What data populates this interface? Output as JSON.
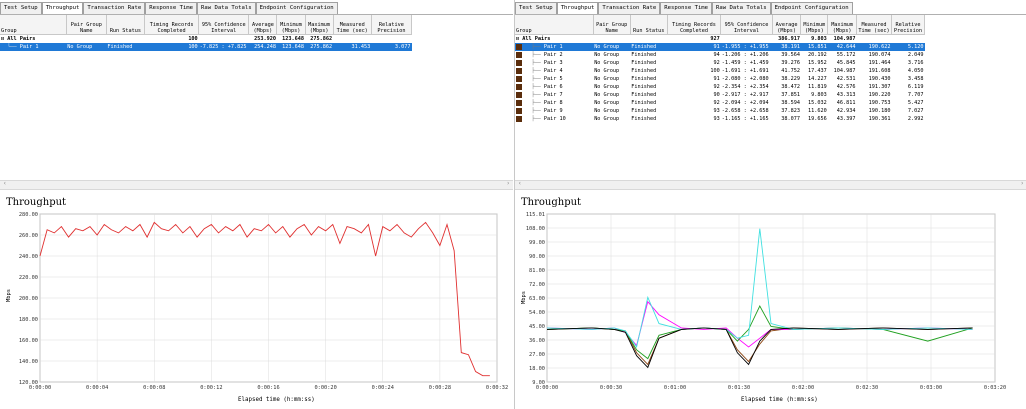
{
  "tabs": [
    "Test Setup",
    "Throughput",
    "Transaction Rate",
    "Response Time",
    "Raw Data Totals",
    "Endpoint Configuration"
  ],
  "left": {
    "headers": [
      "Group",
      "Pair Group Name",
      "Run Status",
      "Timing Records Completed",
      "95% Confidence Interval",
      "Average (Mbps)",
      "Minimum (Mbps)",
      "Maximum (Mbps)",
      "Measured Time (sec)",
      "Relative Precision"
    ],
    "all_pairs": {
      "label": "All Pairs",
      "records": "100",
      "average": "253.920",
      "minimum": "123.648",
      "maximum": "275.862"
    },
    "rows": [
      {
        "pair": "Pair 1",
        "group": "No Group",
        "status": "Finished",
        "records": "100",
        "ci": "-7.825 : +7.825",
        "average": "254.248",
        "minimum": "123.648",
        "maximum": "275.862",
        "time": "31.453",
        "precision": "3.077"
      }
    ],
    "chart_title": "Throughput",
    "y_label": "Mbps",
    "x_label": "Elapsed time (h:mm:ss)",
    "y_ticks": [
      "280.00",
      "260.00",
      "240.00",
      "220.00",
      "200.00",
      "180.00",
      "160.00",
      "140.00",
      "120.00"
    ],
    "x_ticks": [
      "0:00:00",
      "0:00:04",
      "0:00:08",
      "0:00:12",
      "0:00:16",
      "0:00:20",
      "0:00:24",
      "0:00:28",
      "0:00:32"
    ]
  },
  "right": {
    "headers": [
      "Group",
      "Pair Group Name",
      "Run Status",
      "Timing Records Completed",
      "95% Confidence Interval",
      "Average (Mbps)",
      "Minimum (Mbps)",
      "Maximum (Mbps)",
      "Measured Time (sec)",
      "Relative Precision"
    ],
    "all_pairs": {
      "label": "All Pairs",
      "records": "927",
      "average": "386.917",
      "minimum": "9.803",
      "maximum": "104.987"
    },
    "rows": [
      {
        "pair": "Pair 1",
        "group": "No Group",
        "status": "Finished",
        "records": "91",
        "ci": "-1.955 : +1.955",
        "average": "38.191",
        "minimum": "15.851",
        "maximum": "42.644",
        "time": "190.622",
        "precision": "5.120"
      },
      {
        "pair": "Pair 2",
        "group": "No Group",
        "status": "Finished",
        "records": "94",
        "ci": "-1.206 : +1.206",
        "average": "39.564",
        "minimum": "20.192",
        "maximum": "55.172",
        "time": "190.074",
        "precision": "2.049"
      },
      {
        "pair": "Pair 3",
        "group": "No Group",
        "status": "Finished",
        "records": "92",
        "ci": "-1.459 : +1.459",
        "average": "39.276",
        "minimum": "15.952",
        "maximum": "45.845",
        "time": "191.464",
        "precision": "3.716"
      },
      {
        "pair": "Pair 4",
        "group": "No Group",
        "status": "Finished",
        "records": "100",
        "ci": "-1.691 : +1.691",
        "average": "41.752",
        "minimum": "17.437",
        "maximum": "104.987",
        "time": "191.608",
        "precision": "4.050"
      },
      {
        "pair": "Pair 5",
        "group": "No Group",
        "status": "Finished",
        "records": "91",
        "ci": "-2.080 : +2.080",
        "average": "38.229",
        "minimum": "14.227",
        "maximum": "42.531",
        "time": "190.430",
        "precision": "3.458"
      },
      {
        "pair": "Pair 6",
        "group": "No Group",
        "status": "Finished",
        "records": "92",
        "ci": "-2.354 : +2.354",
        "average": "38.472",
        "minimum": "11.819",
        "maximum": "42.576",
        "time": "191.307",
        "precision": "6.119"
      },
      {
        "pair": "Pair 7",
        "group": "No Group",
        "status": "Finished",
        "records": "90",
        "ci": "-2.917 : +2.917",
        "average": "37.851",
        "minimum": "9.803",
        "maximum": "43.313",
        "time": "190.220",
        "precision": "7.707"
      },
      {
        "pair": "Pair 8",
        "group": "No Group",
        "status": "Finished",
        "records": "92",
        "ci": "-2.094 : +2.094",
        "average": "38.594",
        "minimum": "15.032",
        "maximum": "46.811",
        "time": "190.753",
        "precision": "5.427"
      },
      {
        "pair": "Pair 9",
        "group": "No Group",
        "status": "Finished",
        "records": "93",
        "ci": "-2.658 : +2.658",
        "average": "37.823",
        "minimum": "11.620",
        "maximum": "42.934",
        "time": "190.180",
        "precision": "7.027"
      },
      {
        "pair": "Pair 10",
        "group": "No Group",
        "status": "Finished",
        "records": "93",
        "ci": "-1.165 : +1.165",
        "average": "38.077",
        "minimum": "19.656",
        "maximum": "43.397",
        "time": "190.361",
        "precision": "2.992"
      }
    ],
    "chart_title": "Throughput",
    "y_label": "Mbps",
    "x_label": "Elapsed time (h:mm:ss)",
    "y_ticks": [
      "115.01",
      "108.00",
      "99.00",
      "90.00",
      "81.00",
      "72.00",
      "63.00",
      "54.00",
      "45.00",
      "36.00",
      "27.00",
      "18.00",
      "9.00"
    ],
    "x_ticks": [
      "0:00:00",
      "0:00:30",
      "0:01:00",
      "0:01:30",
      "0:02:00",
      "0:02:30",
      "0:03:00",
      "0:03:20"
    ]
  },
  "chart_data": [
    {
      "type": "line",
      "title": "Throughput",
      "xlabel": "Elapsed time (h:mm:ss)",
      "ylabel": "Mbps",
      "ylim": [
        120,
        280
      ],
      "xlim": [
        0,
        32
      ],
      "series": [
        {
          "name": "Pair 1",
          "color": "#e03030",
          "x": [
            0,
            0.5,
            1,
            1.5,
            2,
            2.5,
            3,
            3.5,
            4,
            4.5,
            5,
            5.5,
            6,
            6.5,
            7,
            7.5,
            8,
            8.5,
            9,
            9.5,
            10,
            10.5,
            11,
            11.5,
            12,
            12.5,
            13,
            13.5,
            14,
            14.5,
            15,
            15.5,
            16,
            16.5,
            17,
            17.5,
            18,
            18.5,
            19,
            19.5,
            20,
            20.5,
            21,
            21.5,
            22,
            22.5,
            23,
            23.5,
            24,
            24.5,
            25,
            25.5,
            26,
            26.5,
            27,
            27.5,
            28,
            28.5,
            29,
            29.5,
            30,
            30.5,
            31,
            31.5
          ],
          "values": [
            240,
            265,
            262,
            268,
            258,
            266,
            264,
            268,
            260,
            270,
            265,
            262,
            268,
            264,
            270,
            258,
            272,
            266,
            264,
            270,
            262,
            268,
            258,
            266,
            270,
            262,
            268,
            264,
            270,
            258,
            266,
            264,
            270,
            262,
            268,
            258,
            266,
            270,
            260,
            268,
            264,
            270,
            252,
            268,
            266,
            262,
            270,
            240,
            268,
            264,
            270,
            262,
            258,
            266,
            272,
            262,
            250,
            270,
            245,
            148,
            146,
            130,
            126,
            126
          ]
        }
      ]
    },
    {
      "type": "line",
      "title": "Throughput",
      "xlabel": "Elapsed time (h:mm:ss)",
      "ylabel": "Mbps",
      "ylim": [
        0,
        115.01
      ],
      "xlim": [
        0,
        200
      ],
      "series": [
        {
          "name": "Pair 1",
          "color": "#8b4513",
          "x": [
            0,
            20,
            30,
            35,
            40,
            45,
            50,
            60,
            70,
            80,
            85,
            90,
            95,
            100,
            110,
            130,
            150,
            170,
            190
          ],
          "values": [
            36,
            37,
            36,
            35,
            20,
            12,
            30,
            36,
            37,
            36,
            22,
            14,
            26,
            35,
            37,
            36,
            37,
            36,
            37
          ]
        },
        {
          "name": "Pair 2",
          "color": "#ff00ff",
          "x": [
            0,
            20,
            30,
            35,
            40,
            45,
            50,
            60,
            70,
            80,
            85,
            90,
            95,
            100,
            110,
            130,
            150,
            170,
            190
          ],
          "values": [
            37,
            36,
            37,
            34,
            25,
            55,
            46,
            37,
            36,
            37,
            30,
            24,
            30,
            36,
            36,
            37,
            36,
            37,
            36
          ]
        },
        {
          "name": "Pair 3",
          "color": "#20a020",
          "x": [
            0,
            20,
            30,
            35,
            40,
            45,
            50,
            60,
            70,
            80,
            85,
            90,
            95,
            100,
            110,
            130,
            150,
            170,
            190
          ],
          "values": [
            36,
            37,
            36,
            35,
            22,
            16,
            32,
            36,
            37,
            36,
            28,
            36,
            52,
            38,
            36,
            37,
            36,
            28,
            37
          ]
        },
        {
          "name": "Pair 4",
          "color": "#40e0e0",
          "x": [
            0,
            20,
            30,
            35,
            40,
            45,
            50,
            60,
            70,
            80,
            85,
            90,
            95,
            100,
            110,
            130,
            150,
            170,
            190
          ],
          "values": [
            37,
            36,
            37,
            35,
            24,
            58,
            40,
            36,
            37,
            36,
            30,
            32,
            105,
            40,
            36,
            37,
            36,
            37,
            36
          ]
        },
        {
          "name": "Pair 5",
          "color": "#000000",
          "x": [
            0,
            20,
            30,
            35,
            40,
            45,
            50,
            60,
            70,
            80,
            85,
            90,
            95,
            100,
            110,
            130,
            150,
            170,
            190
          ],
          "values": [
            36,
            37,
            36,
            34,
            18,
            10,
            30,
            36,
            37,
            36,
            20,
            12,
            28,
            36,
            37,
            36,
            37,
            36,
            37
          ]
        }
      ]
    }
  ]
}
